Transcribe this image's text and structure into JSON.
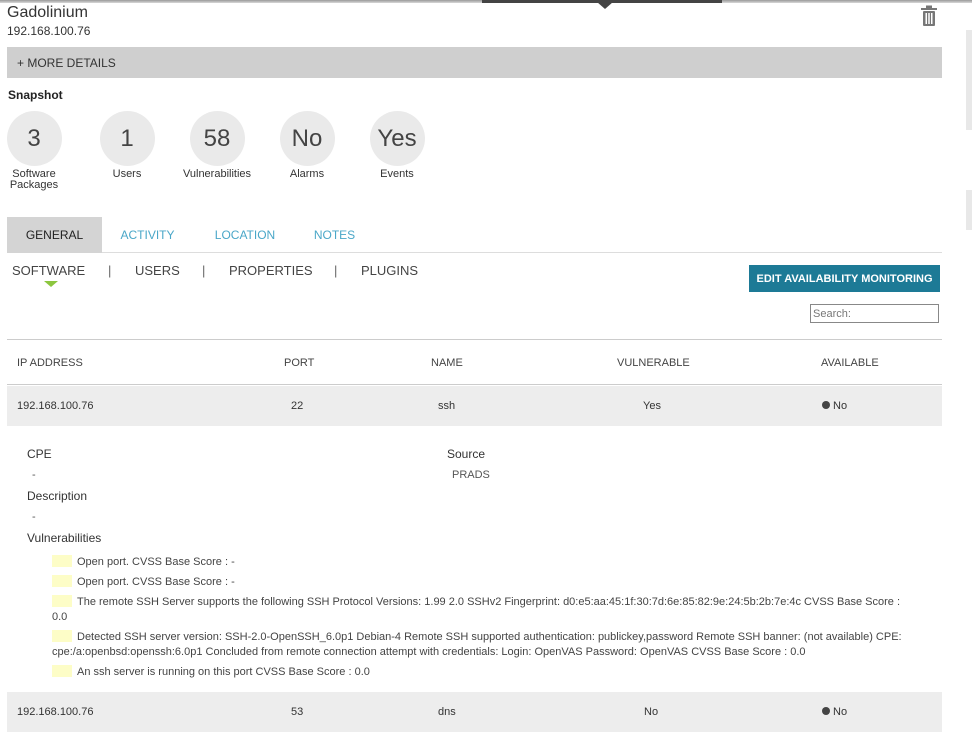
{
  "asset": {
    "name": "Gadolinium",
    "ip": "192.168.100.76"
  },
  "more_details_label": "+ MORE DETAILS",
  "snapshot": {
    "title": "Snapshot",
    "stats": [
      {
        "value": "3",
        "label": "Software Packages"
      },
      {
        "value": "1",
        "label": "Users"
      },
      {
        "value": "58",
        "label": "Vulnerabilities"
      },
      {
        "value": "No",
        "label": "Alarms"
      },
      {
        "value": "Yes",
        "label": "Events"
      }
    ]
  },
  "tabs": [
    "GENERAL",
    "ACTIVITY",
    "LOCATION",
    "NOTES"
  ],
  "subnav": [
    "SOFTWARE",
    "USERS",
    "PROPERTIES",
    "PLUGINS"
  ],
  "subnav_separator": "|",
  "edit_button": "EDIT AVAILABILITY MONITORING",
  "search_placeholder": "Search:",
  "table": {
    "headers": [
      "IP ADDRESS",
      "PORT",
      "NAME",
      "VULNERABLE",
      "AVAILABLE"
    ],
    "rows": [
      {
        "ip": "192.168.100.76",
        "port": "22",
        "name": "ssh",
        "vulnerable": "Yes",
        "available": "No"
      },
      {
        "ip": "192.168.100.76",
        "port": "53",
        "name": "dns",
        "vulnerable": "No",
        "available": "No"
      }
    ]
  },
  "detail": {
    "cpe_label": "CPE",
    "cpe_value": "-",
    "source_label": "Source",
    "source_value": "PRADS",
    "description_label": "Description",
    "description_value": "-",
    "vulnerabilities_label": "Vulnerabilities",
    "vulnerabilities": [
      "Open port. CVSS Base Score : -",
      "Open port. CVSS Base Score : -",
      "The remote SSH Server supports the following SSH Protocol Versions: 1.99 2.0 SSHv2 Fingerprint: d0:e5:aa:45:1f:30:7d:6e:85:82:9e:24:5b:2b:7e:4c CVSS Base Score : 0.0",
      "Detected SSH server version: SSH-2.0-OpenSSH_6.0p1 Debian-4 Remote SSH supported authentication: publickey,password Remote SSH banner: (not available) CPE: cpe:/a:openbsd:openssh:6.0p1 Concluded from remote connection attempt with credentials: Login: OpenVAS Password: OpenVAS CVSS Base Score : 0.0",
      "An ssh server is running on this port CVSS Base Score : 0.0"
    ]
  },
  "colors": {
    "accent": "#1d7a96",
    "tab_link": "#4aa7c8",
    "arrow": "#8cc63f",
    "vuln_swatch": "#fdfdc7"
  },
  "icons": {
    "delete": "trash-icon"
  }
}
